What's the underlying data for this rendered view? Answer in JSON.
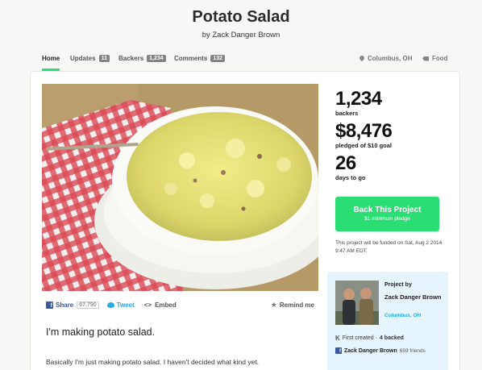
{
  "header": {
    "title": "Potato Salad",
    "byline": "by Zack Danger Brown"
  },
  "nav": {
    "home": "Home",
    "updates": "Updates",
    "updates_count": "11",
    "backers": "Backers",
    "backers_count": "1,234",
    "comments": "Comments",
    "comments_count": "132",
    "location": "Columbus, OH",
    "category": "Food"
  },
  "share": {
    "share_label": "Share",
    "share_count": "67,790",
    "tweet_label": "Tweet",
    "embed_label": "Embed",
    "remind_label": "Remind me"
  },
  "description": {
    "heading": "I'm making potato salad.",
    "body": "Basically I'm just making potato salad. I haven't decided what kind yet."
  },
  "stats": {
    "backers_value": "1,234",
    "backers_label": "backers",
    "pledged_value": "$8,476",
    "pledged_label": "pledged of $10 goal",
    "days_value": "26",
    "days_label": "days to go"
  },
  "cta": {
    "title": "Back This Project",
    "subtitle": "$1 minimum pledge"
  },
  "funding_note": "This project will be funded on Sat, Aug 2 2014 9:47 AM EDT.",
  "creator": {
    "project_by": "Project by",
    "name": "Zack Danger Brown",
    "location": "Columbus, OH",
    "created_text": "First created · ",
    "backed_text": "4 backed",
    "fb_name": "Zack Danger Brown",
    "fb_friends": "659 friends"
  },
  "colors": {
    "accent": "#2bde73",
    "facebook": "#3b5998",
    "twitter": "#2aa9e0",
    "creator_bg": "#e6f4fb"
  },
  "icons": [
    "location-pin-icon",
    "tag-icon",
    "facebook-icon",
    "twitter-icon",
    "embed-icon",
    "star-icon",
    "kickstarter-icon"
  ]
}
